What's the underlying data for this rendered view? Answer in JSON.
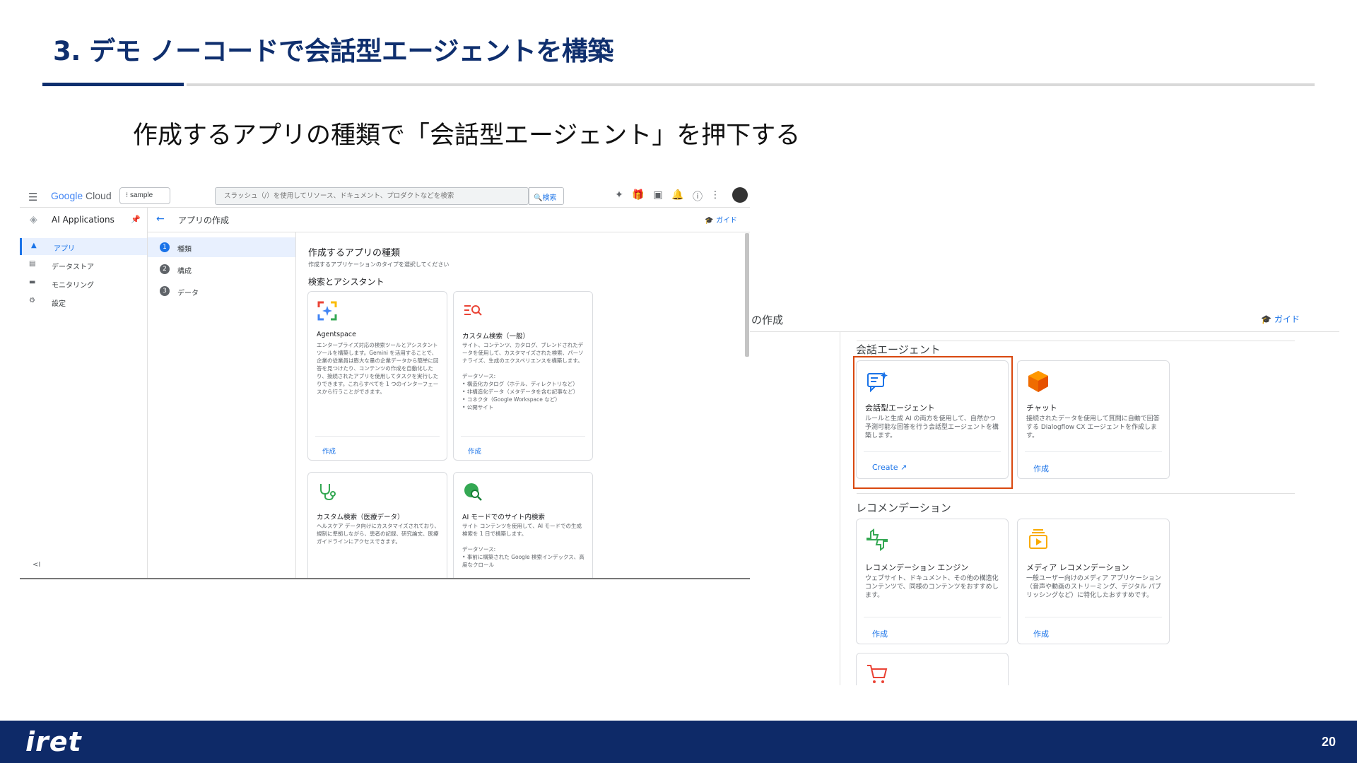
{
  "slide": {
    "title": "3. デモ ノーコードで会話型エージェントを構築",
    "subtitle": "作成するアプリの種類で「会話型エージェント」を押下する",
    "logo": "iret",
    "page_number": "20"
  },
  "screenshot_back": {
    "header_title": "の作成",
    "guide": "ガイド",
    "section_conversational": "会話エージェント",
    "section_recommendation": "レコメンデーション",
    "cards": [
      {
        "title": "会話型エージェント",
        "desc": "ルールと生成 AI の両方を使用して、自然かつ予測可能な回答を行う会話型エージェントを構築します。",
        "action": "Create",
        "icon": "chat-sparkle-icon"
      },
      {
        "title": "チャット",
        "desc": "接続されたデータを使用して質問に自動で回答する Dialogflow CX エージェントを作成します。",
        "action": "作成",
        "icon": "dialogflow-cube-icon"
      },
      {
        "title": "レコメンデーション エンジン",
        "desc": "ウェブサイト、ドキュメント、その他の構造化コンテンツで、同様のコンテンツをおすすめします。",
        "action": "作成",
        "icon": "thumbs-icon"
      },
      {
        "title": "メディア レコメンデーション",
        "desc": "一般ユーザー向けのメディア アプリケーション（音声や動画のストリーミング、デジタル パブリッシングなど）に特化したおすすめです。",
        "action": "作成",
        "icon": "media-icon"
      }
    ],
    "collapse": "<I"
  },
  "screenshot_front": {
    "topbar": {
      "logo_google": "Google",
      "logo_cloud": " Cloud",
      "project": "sample",
      "search_placeholder": "スラッシュ（/）を使用してリソース、ドキュメント、プロダクトなどを検索",
      "search_button": "検索"
    },
    "nav": {
      "title": "AI Applications",
      "items": [
        {
          "label": "アプリ",
          "icon": "apps-icon"
        },
        {
          "label": "データストア",
          "icon": "datastore-icon"
        },
        {
          "label": "モニタリング",
          "icon": "monitor-icon"
        },
        {
          "label": "設定",
          "icon": "settings-icon"
        }
      ],
      "collapse": "<I"
    },
    "page_header": {
      "title": "アプリの作成",
      "guide": "ガイド"
    },
    "steps": [
      {
        "num": "1",
        "label": "種類"
      },
      {
        "num": "2",
        "label": "構成"
      },
      {
        "num": "3",
        "label": "データ"
      }
    ],
    "content": {
      "heading": "作成するアプリの種類",
      "subheading": "作成するアプリケーションのタイプを選択してください",
      "section": "検索とアシスタント",
      "cards": [
        {
          "title": "Agentspace",
          "desc": "エンタープライズ対応の検索ツールとアシスタント ツールを構築します。Gemini を活用することで、企業の従業員は膨大な量の企業データから簡単に回答を見つけたり、コンテンツの作成を自動化したり、接続されたアプリを使用してタスクを実行したりできます。これらすべてを 1 つのインターフェースから行うことができます。",
          "action": "作成"
        },
        {
          "title": "カスタム検索（一般）",
          "desc": "サイト、コンテンツ、カタログ、ブレンドされたデータを使用して、カスタマイズされた検索、パーソナライズ、生成のエクスペリエンスを構築します。\n\nデータソース:\n• 構造化カタログ（ホテル、ディレクトリなど）\n• 非構造化データ（メタデータを含む記事など）\n• コネクタ（Google Workspace など）\n• 公開サイト",
          "action": "作成"
        },
        {
          "title": "カスタム検索（医療データ）",
          "desc": "ヘルスケア データ向けにカスタマイズされており、規制に準拠しながら、患者の記録、研究論文、医療ガイドラインにアクセスできます。",
          "action": ""
        },
        {
          "title": "AI モードでのサイト内検索",
          "desc": "サイト コンテンツを使用して、AI モードでの生成検索を 1 日で構築します。\n\nデータソース:\n• 事前に構築された Google 検索インデックス、高度なクロール",
          "action": ""
        }
      ]
    }
  },
  "colors": {
    "brand_navy": "#0f2f6e",
    "highlight": "#d9480f",
    "link_blue": "#1a73e8"
  }
}
